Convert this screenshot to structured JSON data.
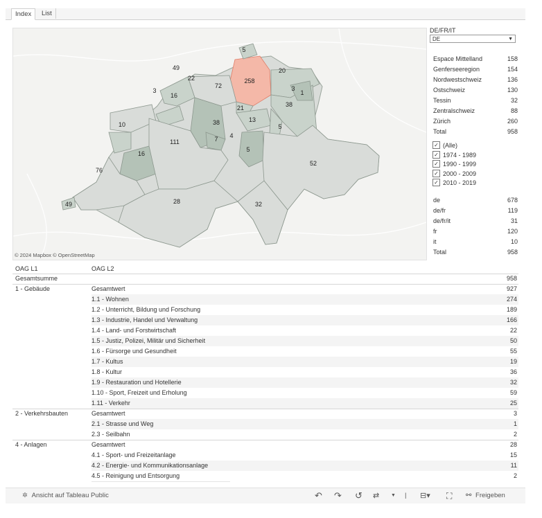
{
  "tabs": [
    "Index",
    "List"
  ],
  "map": {
    "attribution": "© 2024 Mapbox © OpenStreetMap",
    "highlight_color": "#f4b8a8",
    "region_color": "#c9d3cb",
    "region_dark_color": "#b4c2b7",
    "counts": [
      "258",
      "20",
      "72",
      "22",
      "49",
      "3",
      "16",
      "5",
      "3",
      "1",
      "38",
      "21",
      "13",
      "38",
      "5",
      "7",
      "4",
      "5",
      "10",
      "16",
      "111",
      "76",
      "52",
      "28",
      "32",
      "49"
    ]
  },
  "language_filter": {
    "title": "DE/FR/IT",
    "selected": "DE"
  },
  "regions": [
    {
      "name": "Espace Mittelland",
      "value": "158"
    },
    {
      "name": "Genferseeregion",
      "value": "154"
    },
    {
      "name": "Nordwestschweiz",
      "value": "136"
    },
    {
      "name": "Ostschweiz",
      "value": "130"
    },
    {
      "name": "Tessin",
      "value": "32"
    },
    {
      "name": "Zentralschweiz",
      "value": "88"
    },
    {
      "name": "Zürich",
      "value": "260"
    },
    {
      "name": "Total",
      "value": "958"
    }
  ],
  "period_filter": [
    "(Alle)",
    "1974 - 1989",
    "1990 - 1999",
    "2000 - 2009",
    "2010 - 2019"
  ],
  "languages": [
    {
      "name": "de",
      "value": "678"
    },
    {
      "name": "de/fr",
      "value": "119"
    },
    {
      "name": "de/fr/it",
      "value": "31"
    },
    {
      "name": "fr",
      "value": "120"
    },
    {
      "name": "it",
      "value": "10"
    },
    {
      "name": "Total",
      "value": "958"
    }
  ],
  "table": {
    "headers": [
      "OAG L1",
      "OAG L2"
    ],
    "grand_total_label": "Gesamtsumme",
    "grand_total": "958",
    "rows": [
      {
        "l1": "1 - Gebäude",
        "l2": "Gesamtwert",
        "v": "927"
      },
      {
        "l1": "",
        "l2": "1.1 - Wohnen",
        "v": "274"
      },
      {
        "l1": "",
        "l2": "1.2 - Unterricht, Bildung und Forschung",
        "v": "189"
      },
      {
        "l1": "",
        "l2": "1.3 - Industrie, Handel und Verwaltung",
        "v": "166"
      },
      {
        "l1": "",
        "l2": "1.4 - Land- und Forstwirtschaft",
        "v": "22"
      },
      {
        "l1": "",
        "l2": "1.5 - Justiz, Polizei, Militär und Sicherheit",
        "v": "50"
      },
      {
        "l1": "",
        "l2": "1.6 - Fürsorge und Gesundheit",
        "v": "55"
      },
      {
        "l1": "",
        "l2": "1.7 - Kultus",
        "v": "19"
      },
      {
        "l1": "",
        "l2": "1.8 - Kultur",
        "v": "36"
      },
      {
        "l1": "",
        "l2": "1.9 - Restauration und Hotellerie",
        "v": "32"
      },
      {
        "l1": "",
        "l2": "1.10 - Sport, Freizeit und Erholung",
        "v": "59"
      },
      {
        "l1": "",
        "l2": "1.11 - Verkehr",
        "v": "25"
      },
      {
        "l1": "2 - Verkehrsbauten",
        "l2": "Gesamtwert",
        "v": "3"
      },
      {
        "l1": "",
        "l2": "2.1 - Strasse und Weg",
        "v": "1"
      },
      {
        "l1": "",
        "l2": "2.3 - Seilbahn",
        "v": "2"
      },
      {
        "l1": "4 - Anlagen",
        "l2": "Gesamtwert",
        "v": "28"
      },
      {
        "l1": "",
        "l2": "4.1 - Sport- und Freizeitanlage",
        "v": "15"
      },
      {
        "l1": "",
        "l2": "4.2 - Energie- und Kommunikationsanlage",
        "v": "11"
      },
      {
        "l1": "",
        "l2": "4.5 - Reinigung und Entsorgung",
        "v": "2"
      }
    ]
  },
  "footer": {
    "view_label": "Ansicht auf Tableau Public",
    "share_label": "Freigeben"
  }
}
